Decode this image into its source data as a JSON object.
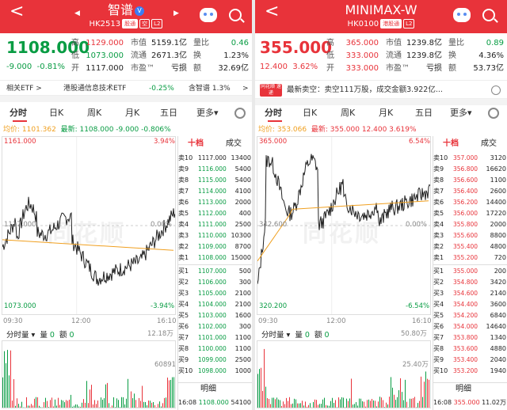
{
  "left": {
    "back_icon": "<",
    "title": "智谱",
    "verified_badge": "V",
    "code": "HK2513",
    "tag_connect": "股通",
    "tag_short": "空",
    "tag_level": "L2",
    "price": "1108.000",
    "change": "-9.000",
    "change_pct": "-0.81%",
    "quote": [
      {
        "l": "高",
        "v": "1129.000",
        "c": "r"
      },
      {
        "l": "市值",
        "v": "5159.1亿",
        "c": "k"
      },
      {
        "l": "量比",
        "v": "0.46",
        "c": "g"
      },
      {
        "l": "低",
        "v": "1073.000",
        "c": "g"
      },
      {
        "l": "流通",
        "v": "2671.3亿",
        "c": "k"
      },
      {
        "l": "换",
        "v": "1.23%",
        "c": "k"
      },
      {
        "l": "开",
        "v": "1117.000",
        "c": "k"
      },
      {
        "l": "市盈™",
        "v": "亏损",
        "c": "k"
      },
      {
        "l": "额",
        "v": "32.69亿",
        "c": "k"
      }
    ],
    "etf": {
      "label": "相关ETF >",
      "name": "港股通信息技术ETF",
      "pct": "-0.25%",
      "other": "含智谱 1.3%",
      "chevron": ">"
    },
    "tabs": [
      "分时",
      "日K",
      "周K",
      "月K",
      "五日",
      "更多▾"
    ],
    "avg_label": "均价: 1101.362",
    "latest_label": "最新: 1108.000 -9.000 -0.806%",
    "y_max": "1161.000",
    "y_max_pct": "3.94%",
    "y_mid": "1117.000",
    "y_mid_pct": "0.00%",
    "y_min": "1073.000",
    "y_min_pct": "-3.94%",
    "time_start": "09:30",
    "time_mid": "12:00",
    "time_end": "16:10",
    "vol_label": "分时量 ▾",
    "vol_l": "量",
    "vol_v": "0",
    "amt_l": "额",
    "amt_v": "0",
    "vol_max": "12.18万",
    "vol_mid": "60891",
    "ob_tabs": [
      "十档",
      "成交"
    ],
    "asks": [
      [
        "卖10",
        "1117.000",
        "13400"
      ],
      [
        "卖9",
        "1116.000",
        "5400"
      ],
      [
        "卖8",
        "1115.000",
        "5400"
      ],
      [
        "卖7",
        "1114.000",
        "4100"
      ],
      [
        "卖6",
        "1113.000",
        "2000"
      ],
      [
        "卖5",
        "1112.000",
        "400"
      ],
      [
        "卖4",
        "1111.000",
        "2500"
      ],
      [
        "卖3",
        "1110.000",
        "10300"
      ],
      [
        "卖2",
        "1109.000",
        "8700"
      ],
      [
        "卖1",
        "1108.000",
        "15000"
      ]
    ],
    "bids": [
      [
        "买1",
        "1107.000",
        "500"
      ],
      [
        "买2",
        "1106.000",
        "300"
      ],
      [
        "买3",
        "1105.000",
        "2100"
      ],
      [
        "买4",
        "1104.000",
        "2100"
      ],
      [
        "买5",
        "1103.000",
        "1600"
      ],
      [
        "买6",
        "1102.000",
        "300"
      ],
      [
        "买7",
        "1101.000",
        "1100"
      ],
      [
        "买8",
        "1100.000",
        "1100"
      ],
      [
        "买9",
        "1099.000",
        "2500"
      ],
      [
        "买10",
        "1098.000",
        "1000"
      ]
    ],
    "detail_tab": "明细",
    "trade_time": "16:08",
    "trade_price": "1108.000",
    "trade_vol": "54100"
  },
  "right": {
    "back_icon": "<",
    "title": "MINIMAX-W",
    "code": "HK0100",
    "tag_connect": "港股通",
    "tag_level": "L2",
    "price": "355.000",
    "change": "12.400",
    "change_pct": "3.62%",
    "quote": [
      {
        "l": "高",
        "v": "365.000",
        "c": "r"
      },
      {
        "l": "市值",
        "v": "1239.8亿",
        "c": "k"
      },
      {
        "l": "量比",
        "v": "0.89",
        "c": "g"
      },
      {
        "l": "低",
        "v": "333.000",
        "c": "r"
      },
      {
        "l": "流通",
        "v": "1239.8亿",
        "c": "k"
      },
      {
        "l": "换",
        "v": "4.36%",
        "c": "k"
      },
      {
        "l": "开",
        "v": "333.000",
        "c": "r"
      },
      {
        "l": "市盈™",
        "v": "亏损",
        "c": "k"
      },
      {
        "l": "额",
        "v": "53.73亿",
        "c": "k"
      }
    ],
    "news_badge": "同花顺 速递",
    "news": "最新卖空：卖空111万股，成交金额3.922亿...",
    "tabs": [
      "分时",
      "日K",
      "周K",
      "月K",
      "五日",
      "更多▾"
    ],
    "avg_label": "均价: 353.066",
    "latest_label": "最新: 355.000 12.400 3.619%",
    "y_max": "365.000",
    "y_max_pct": "6.54%",
    "y_mid": "342.600",
    "y_mid_pct": "0.00%",
    "y_min": "320.200",
    "y_min_pct": "-6.54%",
    "time_start": "09:30",
    "time_mid": "12:00",
    "time_end": "16:10",
    "vol_label": "分时量 ▾",
    "vol_l": "量",
    "vol_v": "0",
    "amt_l": "额",
    "amt_v": "0",
    "vol_max": "50.80万",
    "vol_mid": "25.40万",
    "ob_tabs": [
      "十档",
      "成交"
    ],
    "asks": [
      [
        "卖10",
        "357.000",
        "3120"
      ],
      [
        "卖9",
        "356.800",
        "16620"
      ],
      [
        "卖8",
        "356.600",
        "1100"
      ],
      [
        "卖7",
        "356.400",
        "2600"
      ],
      [
        "卖6",
        "356.200",
        "14400"
      ],
      [
        "卖5",
        "356.000",
        "17220"
      ],
      [
        "卖4",
        "355.800",
        "2000"
      ],
      [
        "卖3",
        "355.600",
        "8800"
      ],
      [
        "卖2",
        "355.400",
        "4800"
      ],
      [
        "卖1",
        "355.200",
        "720"
      ]
    ],
    "bids": [
      [
        "买1",
        "355.000",
        "200"
      ],
      [
        "买2",
        "354.800",
        "3420"
      ],
      [
        "买3",
        "354.600",
        "2140"
      ],
      [
        "买4",
        "354.400",
        "3600"
      ],
      [
        "买5",
        "354.200",
        "6840"
      ],
      [
        "买6",
        "354.000",
        "14640"
      ],
      [
        "买7",
        "353.800",
        "1340"
      ],
      [
        "买8",
        "353.600",
        "4880"
      ],
      [
        "买9",
        "353.400",
        "2040"
      ],
      [
        "买10",
        "353.200",
        "1940"
      ]
    ],
    "detail_tab": "明细",
    "trade_time": "16:08",
    "trade_price": "355.000",
    "trade_vol": "11.02万"
  },
  "watermark": "同花顺",
  "colors": {
    "up": "#e8333a",
    "down": "#089c43",
    "avg_line": "#f0a020",
    "price_line": "#222222"
  },
  "icons": [
    "back-arrow-icon",
    "robot-assistant-icon",
    "search-icon",
    "gear-icon",
    "chevron-down-icon"
  ]
}
